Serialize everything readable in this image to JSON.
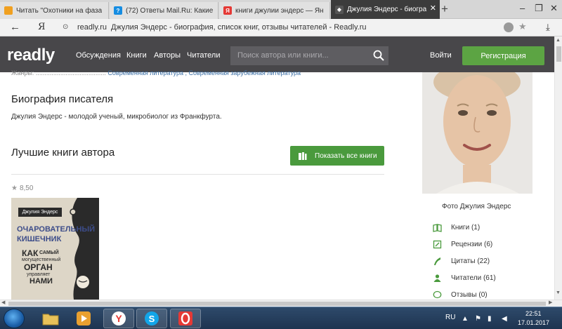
{
  "browser": {
    "tabs": [
      {
        "title": "Читать \"Охотники на фаза",
        "favicon_color": "#f0a020"
      },
      {
        "title": "(72) Ответы Mail.Ru: Какие —",
        "favicon_color": "#168de2"
      },
      {
        "title": "книги джулии эндерс — Ян",
        "favicon_color": "#e53935"
      },
      {
        "title": "Джулия Эндерс - биогра",
        "favicon_color": "#2b2b2b",
        "active": true
      }
    ],
    "new_tab": "+",
    "address": {
      "yandex_logo": "Я",
      "host": "readly.ru",
      "page_title": "Джулия Эндерс - биография, список книг, отзывы читателей - Readly.ru"
    }
  },
  "site": {
    "logo": "readly",
    "nav": [
      "Обсуждения",
      "Книги",
      "Авторы",
      "Читатели"
    ],
    "search_placeholder": "Поиск автора или книги...",
    "login": "Войти",
    "register": "Регистрация",
    "brand_green": "#5ca443"
  },
  "main": {
    "genre_label": "Жанры: ........................................",
    "genre_value": "Современная литература , Современная зарубежная литература",
    "bio_heading": "Биография писателя",
    "bio_text": "Джулия Эндерс - молодой ученый, микробиолог из Франкфурта.",
    "best_heading": "Лучшие книги автора",
    "show_all": "Показать все книги",
    "rating": "8,50",
    "book": {
      "author": "Джулия Эндерс",
      "title_1": "ОЧАРОВАТЕЛЬНЫЙ",
      "title_2": "КИШЕЧНИК",
      "sub_1": "КАК",
      "sub_2": "САМЫЙ",
      "sub_3": "могущественный",
      "sub_4": "ОРГАН",
      "sub_5": "управляет",
      "sub_6": "НАМИ"
    }
  },
  "sidebar": {
    "photo_caption": "Фото Джулия Эндерс",
    "items": [
      {
        "label": "Книги (1)",
        "icon": "book-icon"
      },
      {
        "label": "Рецензии (6)",
        "icon": "reviews-icon"
      },
      {
        "label": "Цитаты (22)",
        "icon": "quote-icon"
      },
      {
        "label": "Читатели (61)",
        "icon": "readers-icon"
      },
      {
        "label": "Отзывы (0)",
        "icon": "comment-icon"
      }
    ]
  },
  "taskbar": {
    "lang": "RU",
    "time": "22:51",
    "date": "17.01.2017"
  }
}
